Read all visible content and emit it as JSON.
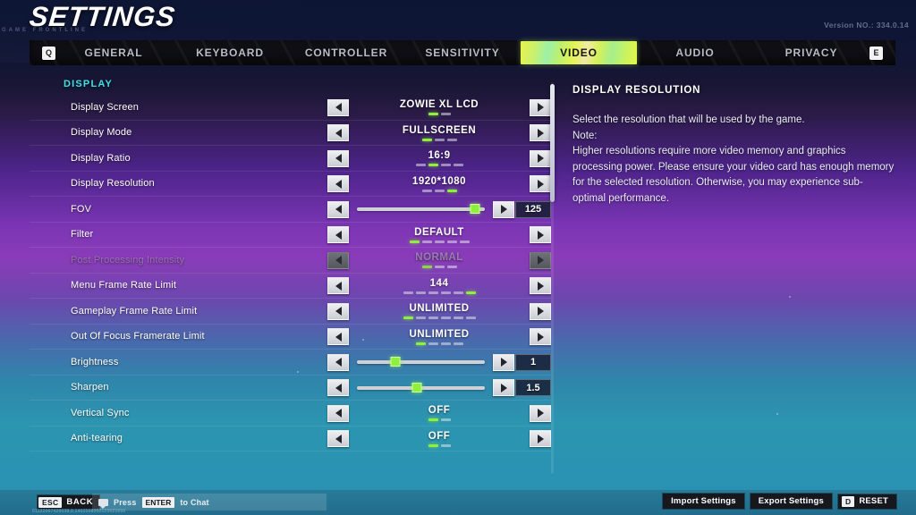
{
  "header": {
    "title": "SETTINGS",
    "subtitle": "GAME FRONTLINE",
    "version": "Version NO.: 334.0.14"
  },
  "tabs": {
    "left_key": "Q",
    "right_key": "E",
    "items": [
      {
        "label": "GENERAL",
        "active": false
      },
      {
        "label": "KEYBOARD",
        "active": false
      },
      {
        "label": "CONTROLLER",
        "active": false
      },
      {
        "label": "SENSITIVITY",
        "active": false
      },
      {
        "label": "VIDEO",
        "active": true
      },
      {
        "label": "AUDIO",
        "active": false
      },
      {
        "label": "PRIVACY",
        "active": false
      }
    ],
    "active_color": "#cdf05a"
  },
  "settings": {
    "section_title": "DISPLAY",
    "rows": [
      {
        "label": "Display Screen",
        "type": "option",
        "value": "ZOWIE XL LCD",
        "option_count": 2,
        "option_index": 0,
        "disabled": false
      },
      {
        "label": "Display Mode",
        "type": "option",
        "value": "FULLSCREEN",
        "option_count": 3,
        "option_index": 0,
        "disabled": false
      },
      {
        "label": "Display Ratio",
        "type": "option",
        "value": "16:9",
        "option_count": 4,
        "option_index": 1,
        "disabled": false
      },
      {
        "label": "Display Resolution",
        "type": "option",
        "value": "1920*1080",
        "option_count": 3,
        "option_index": 2,
        "disabled": false
      },
      {
        "label": "FOV",
        "type": "slider",
        "value": "125",
        "fill_percent": 92,
        "disabled": false
      },
      {
        "label": "Filter",
        "type": "option",
        "value": "DEFAULT",
        "option_count": 5,
        "option_index": 0,
        "disabled": false
      },
      {
        "label": "Post Processing Intensity",
        "type": "option",
        "value": "NORMAL",
        "option_count": 3,
        "option_index": 0,
        "disabled": true
      },
      {
        "label": "Menu Frame Rate Limit",
        "type": "option",
        "value": "144",
        "option_count": 6,
        "option_index": 5,
        "disabled": false
      },
      {
        "label": "Gameplay Frame Rate Limit",
        "type": "option",
        "value": "UNLIMITED",
        "option_count": 6,
        "option_index": 0,
        "disabled": false
      },
      {
        "label": "Out Of Focus Framerate Limit",
        "type": "option",
        "value": "UNLIMITED",
        "option_count": 4,
        "option_index": 0,
        "disabled": false
      },
      {
        "label": "Brightness",
        "type": "slider",
        "value": "1",
        "fill_percent": 30,
        "disabled": false
      },
      {
        "label": "Sharpen",
        "type": "slider",
        "value": "1.5",
        "fill_percent": 47,
        "disabled": false
      },
      {
        "label": "Vertical Sync",
        "type": "option",
        "value": "OFF",
        "option_count": 2,
        "option_index": 0,
        "disabled": false
      },
      {
        "label": "Anti-tearing",
        "type": "option",
        "value": "OFF",
        "option_count": 2,
        "option_index": 0,
        "disabled": false
      }
    ],
    "highlight_color": "#8ef03a",
    "section_color": "#3fe0e8"
  },
  "description": {
    "title": "DISPLAY RESOLUTION",
    "body": "Select the resolution that will be used by the game.\nNote:\nHigher resolutions require more video memory and graphics processing power. Please ensure your video card has enough memory for the selected resolution. Otherwise, you may experience sub-optimal performance."
  },
  "bottom": {
    "esc_key": "ESC",
    "esc_label": "BACK",
    "chat_prefix": "Press",
    "chat_key": "ENTER",
    "chat_suffix": "to Chat",
    "build_hash": "01122067420038.0.1402508302123021650",
    "import_label": "Import Settings",
    "export_label": "Export Settings",
    "reset_key": "D",
    "reset_label": "RESET"
  }
}
